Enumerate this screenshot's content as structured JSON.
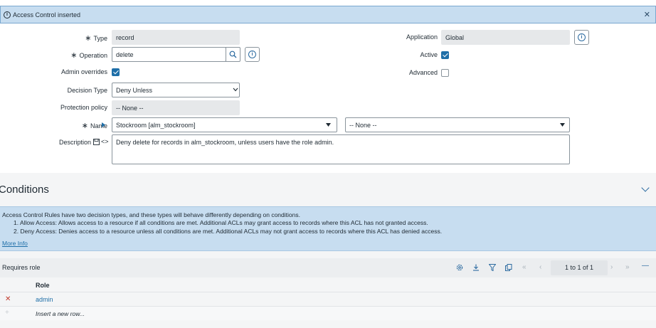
{
  "banner": {
    "message": "Access Control inserted",
    "info_icon": "info-icon",
    "close_icon": "close-icon"
  },
  "form": {
    "type": {
      "label": "Type",
      "value": "record"
    },
    "operation": {
      "label": "Operation",
      "value": "delete"
    },
    "admin_overrides": {
      "label": "Admin overrides",
      "checked": true
    },
    "decision_type": {
      "label": "Decision Type",
      "value": "Deny Unless"
    },
    "protection_policy": {
      "label": "Protection policy",
      "value": "-- None --"
    },
    "name": {
      "label": "Name",
      "table_value": "Stockroom [alm_stockroom]",
      "field_value": "-- None --"
    },
    "description": {
      "label": "Description",
      "value": "Deny delete for records in alm_stockroom, unless users have the role admin."
    },
    "application": {
      "label": "Application",
      "value": "Global"
    },
    "active": {
      "label": "Active",
      "checked": true
    },
    "advanced": {
      "label": "Advanced",
      "checked": false
    },
    "required_marker": "∗"
  },
  "conditions": {
    "title": "Conditions",
    "info": {
      "intro": "Access Control Rules have two decision types, and these types will behave differently depending on conditions.",
      "allow": "1. Allow Access: Allows access to a resource if all conditions are met. Additional ACLs may grant access to records where this ACL has not granted access.",
      "deny": "2. Deny Access: Denies access to a resource unless all conditions are met. Additional ACLs may not grant access to records where this ACL has denied access.",
      "more_info": "More Info"
    }
  },
  "requires_role": {
    "title": "Requires role",
    "pager": "1  to 1 of 1",
    "column_header": "Role",
    "rows": [
      {
        "role": "admin"
      }
    ],
    "insert_row": "Insert a new row..."
  },
  "colors": {
    "accent": "#1f6fa8",
    "banner_bg": "#c7ddf0",
    "delete_red": "#c0392b"
  }
}
